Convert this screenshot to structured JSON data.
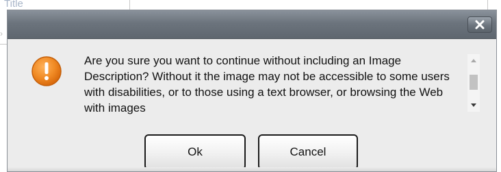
{
  "background": {
    "title_label": "Title"
  },
  "dialog": {
    "close_glyph": "✕",
    "message": "Are you sure you want to continue without including an Image Description? Without it the image may not be accessible to some users with disabilities, or to those using a text browser, or browsing the Web with images",
    "icon": "warning-icon",
    "buttons": {
      "ok_label": "Ok",
      "cancel_label": "Cancel"
    }
  },
  "colors": {
    "warning_orange": "#f08a24",
    "titlebar": "#6c747d"
  }
}
